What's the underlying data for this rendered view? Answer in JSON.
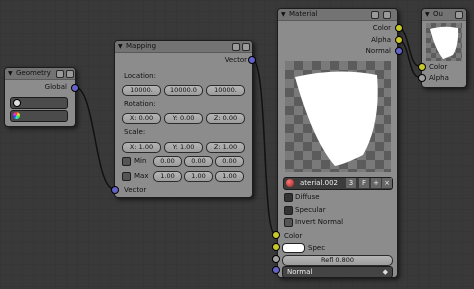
{
  "geometry": {
    "title": "Geometry",
    "out_global": "Global"
  },
  "mapping": {
    "title": "Mapping",
    "out_vector": "Vector",
    "location_label": "Location:",
    "location": [
      "10000.",
      "10000.0",
      "10000."
    ],
    "rotation_label": "Rotation:",
    "rotation": [
      "X: 0.00",
      "Y: 0.00",
      "Z: 0.00"
    ],
    "scale_label": "Scale:",
    "scale": [
      "X: 1.00",
      "Y: 1.00",
      "Z: 1.00"
    ],
    "min_label": "Min",
    "min": [
      "0.00",
      "0.00",
      "0.00"
    ],
    "max_label": "Max",
    "max": [
      "1.00",
      "1.00",
      "1.00"
    ],
    "in_vector": "Vector"
  },
  "material": {
    "title": "Material",
    "out_color": "Color",
    "out_alpha": "Alpha",
    "out_normal": "Normal",
    "mat_name": "aterial.002",
    "users": "3",
    "btn_f": "F",
    "diffuse": "Diffuse",
    "specular": "Specular",
    "invert_normal": "Invert Normal",
    "in_color": "Color",
    "in_spec": "Spec",
    "refl": "Refl 0.800",
    "in_normal": "Normal"
  },
  "output": {
    "title": "Ou",
    "in_color": "Color",
    "in_alpha": "Alpha"
  },
  "colors": {
    "vector_socket": "#6363c7",
    "color_socket": "#c7c729",
    "value_socket": "#a1a1a1",
    "node_body": "#8c8c8c"
  }
}
